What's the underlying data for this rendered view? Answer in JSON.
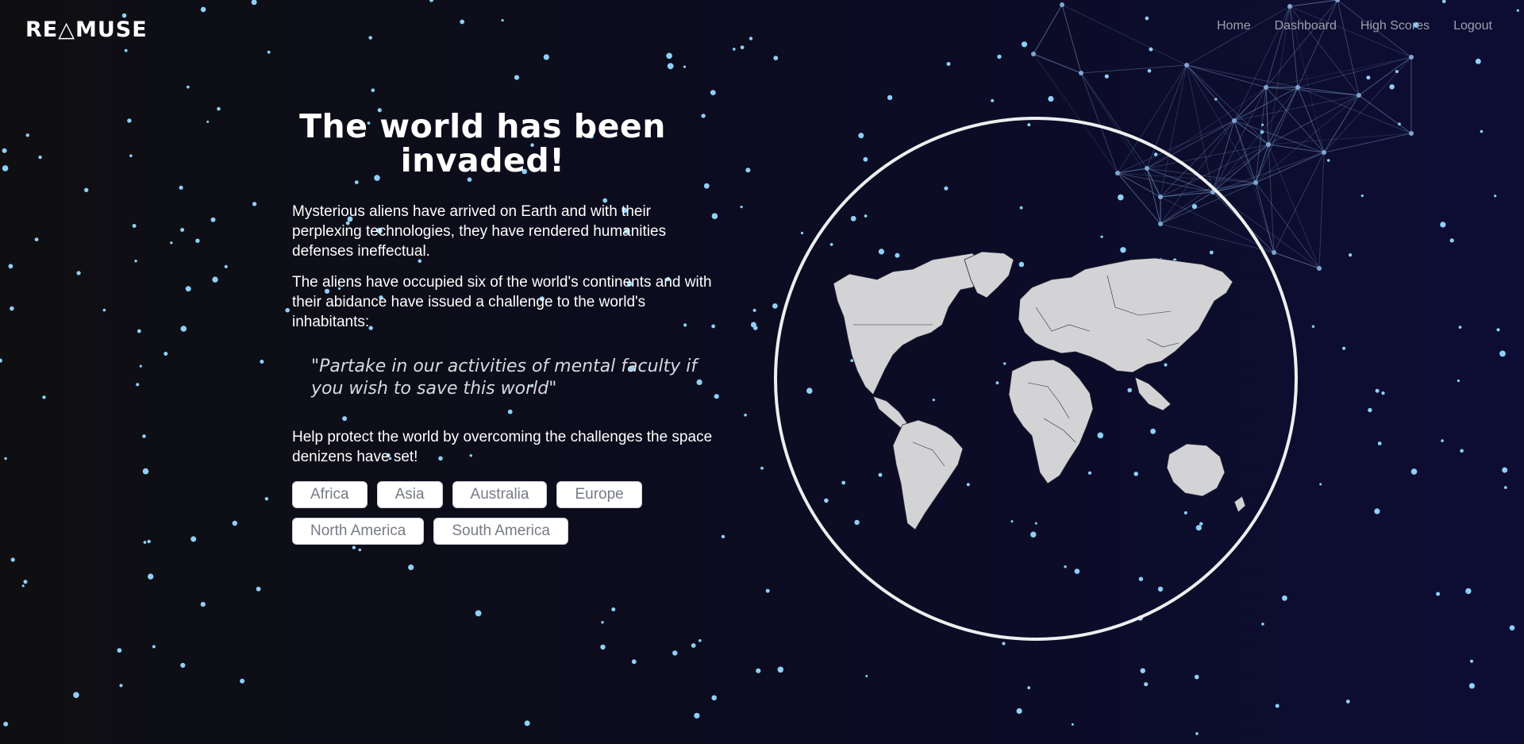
{
  "app": {
    "logo_text": "RE△MUSE"
  },
  "nav": {
    "items": [
      {
        "label": "Home"
      },
      {
        "label": "Dashboard"
      },
      {
        "label": "High Scores"
      },
      {
        "label": "Logout"
      }
    ]
  },
  "hero": {
    "title": "The world has been invaded!",
    "paragraphs": [
      "Mysterious aliens have arrived on Earth and with their perplexing technologies, they have rendered humanities defenses ineffectual.",
      "The aliens have occupied six of the world's continents and with their abidance have issued a challenge to the world's inhabitants:"
    ],
    "quote": "\"Partake in our activities of mental faculty if you wish to save this world\"",
    "call_to_action": "Help protect the world by overcoming the challenges the space denizens have set!"
  },
  "continents": [
    {
      "label": "Africa"
    },
    {
      "label": "Asia"
    },
    {
      "label": "Australia"
    },
    {
      "label": "Europe"
    },
    {
      "label": "North America"
    },
    {
      "label": "South America"
    }
  ],
  "colors": {
    "star": "#8fd0f5",
    "network_line": "#6e8fb8",
    "globe_ring": "#eeeeee",
    "land": "#d3d3d6"
  }
}
